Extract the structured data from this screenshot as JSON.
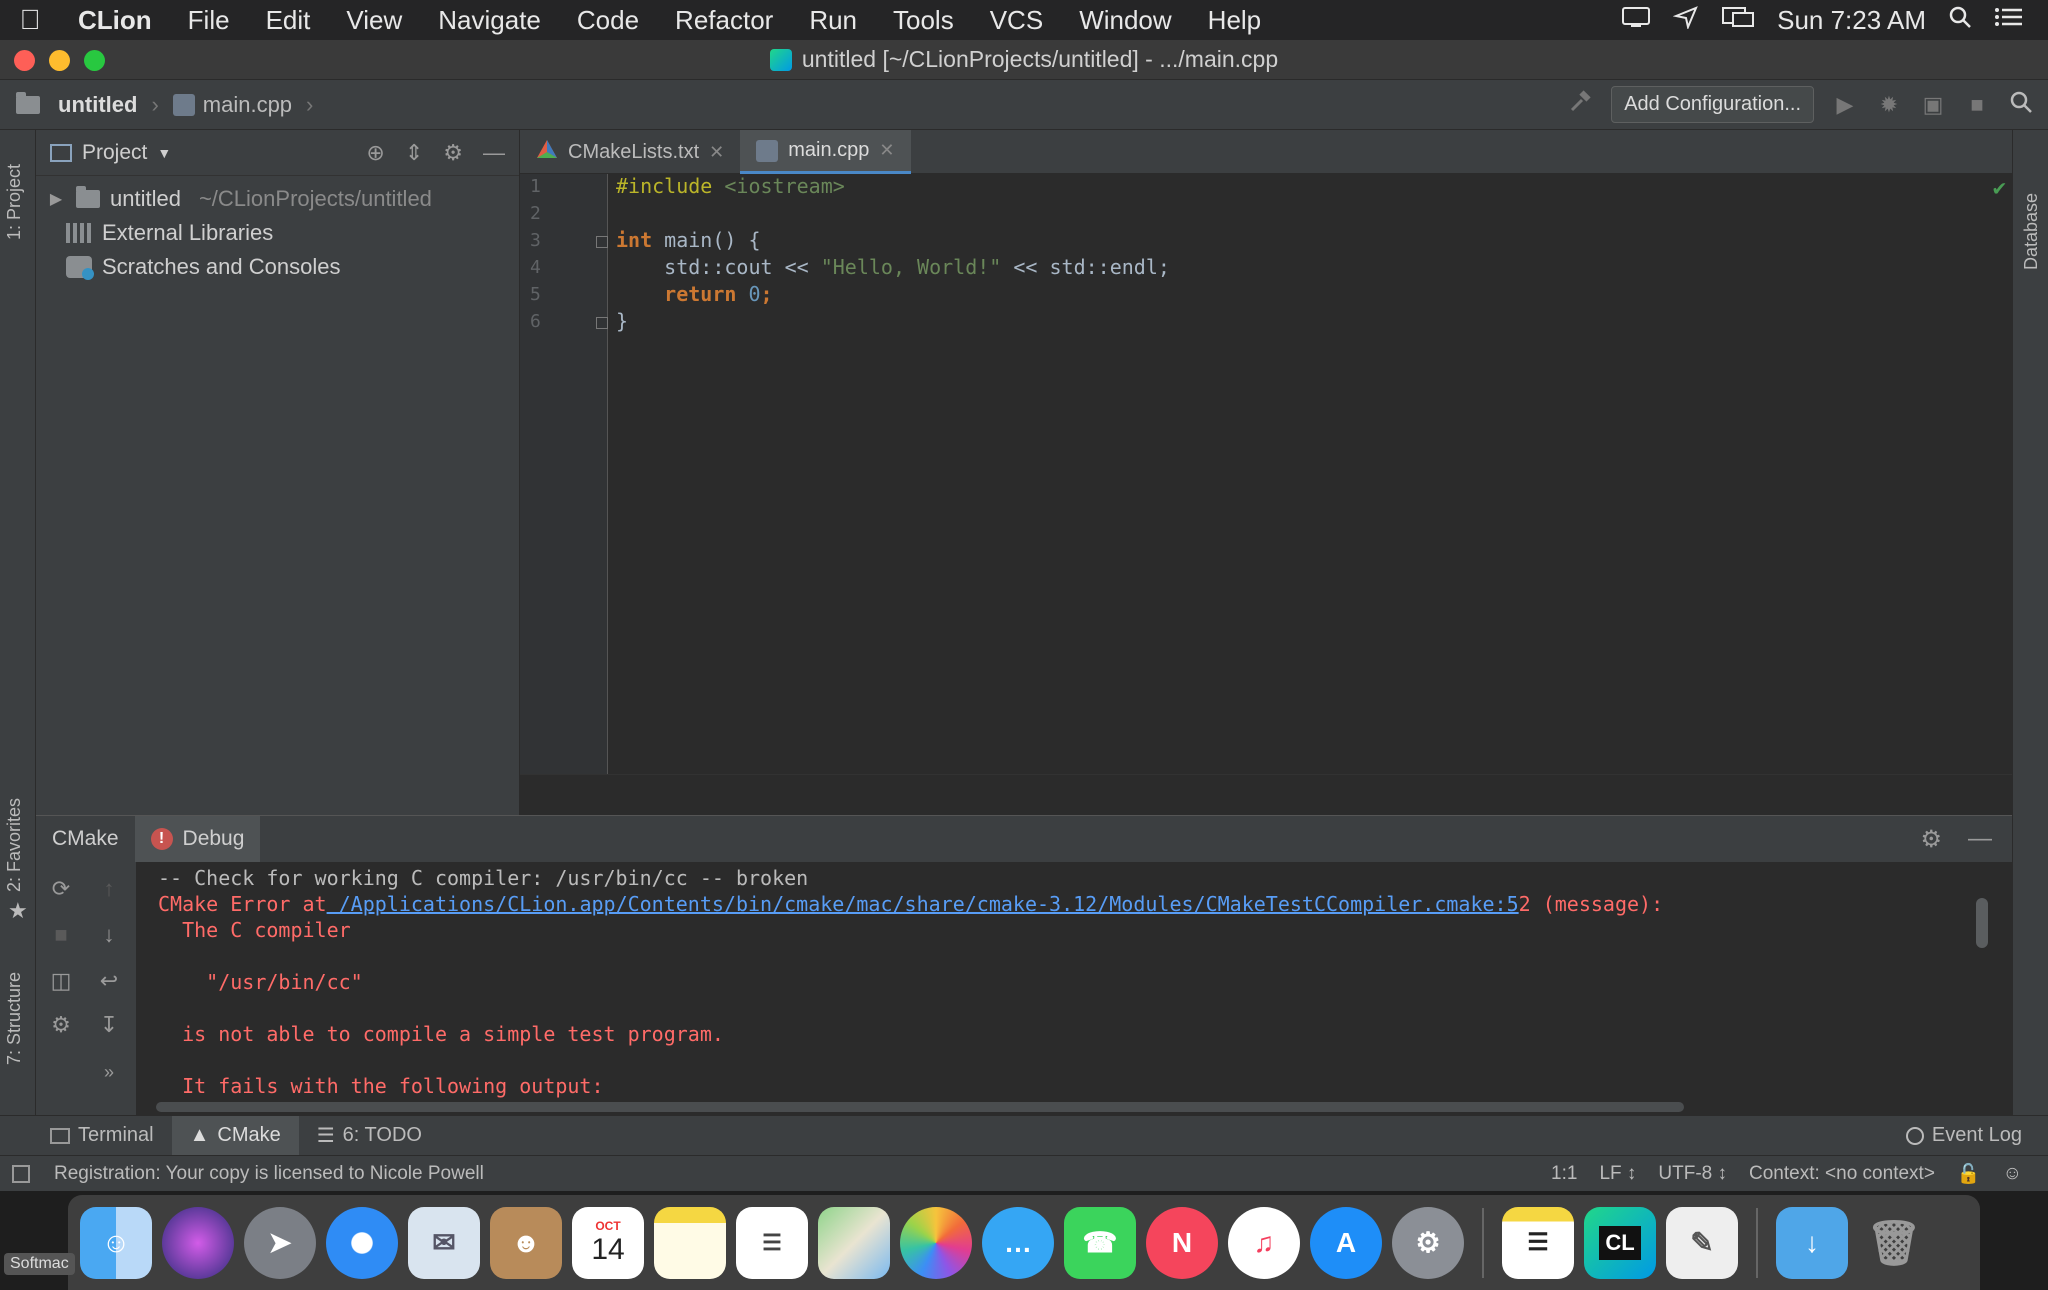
{
  "menubar": {
    "app_name": "CLion",
    "items": [
      "File",
      "Edit",
      "View",
      "Navigate",
      "Code",
      "Refactor",
      "Run",
      "Tools",
      "VCS",
      "Window",
      "Help"
    ],
    "clock": "Sun 7:23 AM"
  },
  "window": {
    "title": "untitled [~/CLionProjects/untitled] - .../main.cpp"
  },
  "navbar": {
    "project": "untitled",
    "file": "main.cpp",
    "add_configuration": "Add Configuration..."
  },
  "left_strip": {
    "project": "1: Project",
    "favorites": "2: Favorites",
    "structure": "7: Structure"
  },
  "right_strip": {
    "database": "Database"
  },
  "project_panel": {
    "title": "Project",
    "tree": [
      {
        "label": "untitled",
        "path": "~/CLionProjects/untitled"
      },
      {
        "label": "External Libraries"
      },
      {
        "label": "Scratches and Consoles"
      }
    ]
  },
  "editor": {
    "tabs": [
      {
        "label": "CMakeLists.txt",
        "active": false
      },
      {
        "label": "main.cpp",
        "active": true
      }
    ],
    "line_numbers": [
      "1",
      "2",
      "3",
      "4",
      "5",
      "6"
    ],
    "code": {
      "l1_directive": "#include",
      "l1_header": " <iostream>",
      "l3_kw": "int",
      "l3_rest": " main() {",
      "l4_a": "    std::cout << ",
      "l4_str": "\"Hello, World!\"",
      "l4_b": " << std::endl;",
      "l5_indent": "    ",
      "l5_kw": "return",
      "l5_num": " 0",
      "l5_end": ";",
      "l6": "}"
    }
  },
  "cmake_window": {
    "tab_cmake": "CMake",
    "tab_debug": "Debug",
    "console": {
      "l1": "-- Check for working C compiler: /usr/bin/cc -- broken",
      "l2_prefix": "CMake Error at",
      "l2_link": " /Applications/CLion.app/Contents/bin/cmake/mac/share/cmake-3.12/Modules/CMakeTestCCompiler.cmake:5",
      "l2_suffix": "2 (message):",
      "l3": "  The C compiler",
      "l4": "    \"/usr/bin/cc\"",
      "l5": "  is not able to compile a simple test program.",
      "l6": "  It fails with the following output:"
    }
  },
  "bottombar": {
    "terminal": "Terminal",
    "cmake": "CMake",
    "todo": "6: TODO",
    "event_log": "Event Log"
  },
  "statusbar": {
    "message": "Registration: Your copy is licensed to Nicole Powell",
    "position": "1:1",
    "line_sep": "LF ↕",
    "encoding": "UTF-8 ↕",
    "context": "Context: <no context>"
  },
  "dock": {
    "calendar_month": "OCT",
    "calendar_day": "14",
    "clion_label": "CL"
  },
  "watermark": "Softmac",
  "colors": {
    "accent": "#4a88c7",
    "error": "#ff6b68",
    "link": "#589df6"
  }
}
